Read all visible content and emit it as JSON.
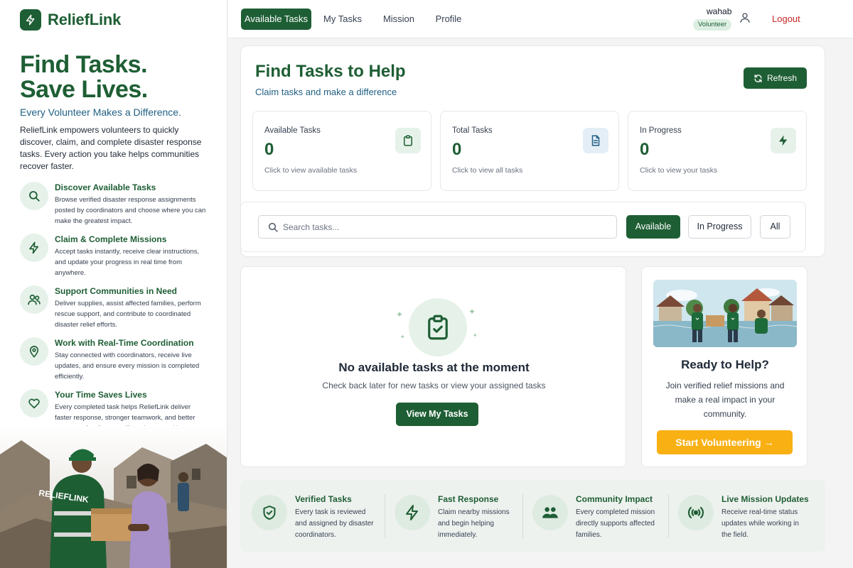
{
  "sidebar": {
    "brand": "ReliefLink",
    "hero_line1": "Find Tasks.",
    "hero_line2": "Save Lives.",
    "tagline": "Every Volunteer Makes a Difference.",
    "description": "ReliefLink empowers volunteers to quickly discover, claim, and complete disaster response tasks. Every action you take helps communities recover faster.",
    "features": [
      {
        "icon": "search-icon",
        "title": "Discover Available Tasks",
        "desc": "Browse verified disaster response assignments posted by coordinators and choose where you can make the greatest impact."
      },
      {
        "icon": "lightning-icon",
        "title": "Claim & Complete Missions",
        "desc": "Accept tasks instantly, receive clear instructions, and update your progress in real time from anywhere."
      },
      {
        "icon": "people-icon",
        "title": "Support Communities in Need",
        "desc": "Deliver supplies, assist affected families, perform rescue support, and contribute to coordinated disaster relief efforts."
      },
      {
        "icon": "location-pin-icon",
        "title": "Work with Real-Time Coordination",
        "desc": "Stay connected with coordinators, receive live updates, and ensure every mission is completed efficiently."
      },
      {
        "icon": "heart-icon",
        "title": "Your Time Saves Lives",
        "desc": "Every completed task helps ReliefLink deliver faster response, stronger teamwork, and better outcomes for disaster-affected communities."
      }
    ],
    "vest_text": "RELIEFLINK"
  },
  "nav": {
    "tabs": [
      "Available Tasks",
      "My Tasks",
      "Mission",
      "Profile"
    ],
    "active_tab": "Available Tasks",
    "user_name": "wahab",
    "role": "Volunteer",
    "logout": "Logout"
  },
  "main": {
    "title": "Find Tasks to Help",
    "subtitle": "Claim tasks and make a difference",
    "refresh": "Refresh",
    "stats": [
      {
        "label": "Available Tasks",
        "value": "0",
        "hint": "Click to view available tasks",
        "icon": "clipboard-icon"
      },
      {
        "label": "Total Tasks",
        "value": "0",
        "hint": "Click to view all tasks",
        "icon": "document-icon"
      },
      {
        "label": "In Progress",
        "value": "0",
        "hint": "Click to view your tasks",
        "icon": "lightning-icon"
      }
    ],
    "search_placeholder": "Search tasks...",
    "filters": [
      "Available",
      "In Progress",
      "All"
    ],
    "active_filter": "Available"
  },
  "empty": {
    "title": "No available tasks at the moment",
    "subtitle": "Check back later for new tasks or view your assigned tasks",
    "button": "View My Tasks"
  },
  "ready": {
    "title": "Ready to Help?",
    "text": "Join verified relief missions and make a real impact in your community.",
    "button": "Start Volunteering →"
  },
  "bottom": [
    {
      "icon": "shield-check-icon",
      "title": "Verified Tasks",
      "desc": "Every task is reviewed and assigned by disaster coordinators."
    },
    {
      "icon": "lightning-icon",
      "title": "Fast Response",
      "desc": "Claim nearby missions and begin helping immediately."
    },
    {
      "icon": "community-icon",
      "title": "Community Impact",
      "desc": "Every completed mission directly supports affected families."
    },
    {
      "icon": "broadcast-icon",
      "title": "Live Mission Updates",
      "desc": "Receive real-time status updates while working in the field."
    }
  ],
  "colors": {
    "primary": "#1e5e34",
    "accent_blue": "#1f5f83",
    "cta": "#f9b013",
    "logout": "#c62828"
  }
}
